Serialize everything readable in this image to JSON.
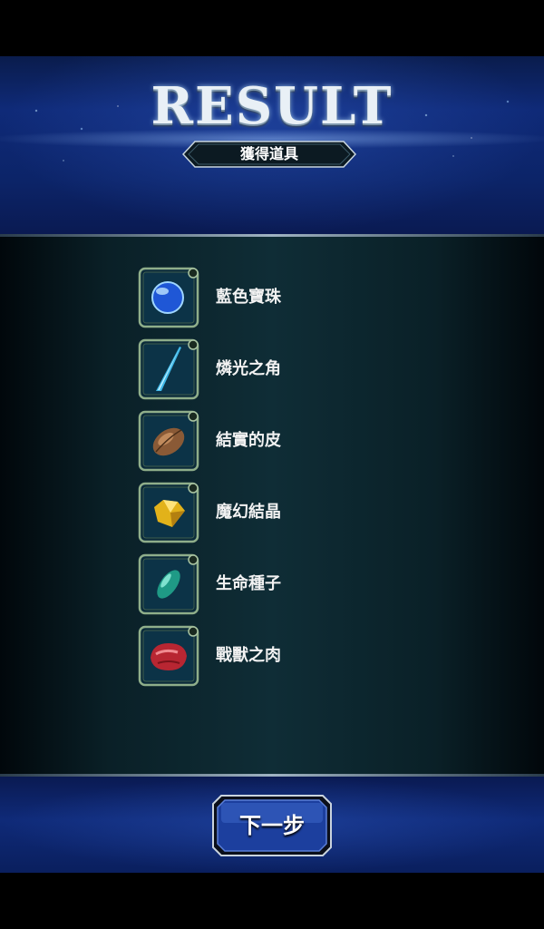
{
  "header": {
    "title": "RESULT",
    "subtitle": "獲得道具"
  },
  "items": [
    {
      "name": "藍色寶珠",
      "icon": "blue-orb-icon"
    },
    {
      "name": "燐光之角",
      "icon": "horn-icon"
    },
    {
      "name": "結實的皮",
      "icon": "hide-icon"
    },
    {
      "name": "魔幻結晶",
      "icon": "crystal-icon"
    },
    {
      "name": "生命種子",
      "icon": "seed-icon"
    },
    {
      "name": "戰獸之肉",
      "icon": "meat-icon"
    }
  ],
  "footer": {
    "next_label": "下一步"
  },
  "colors": {
    "accent_blue": "#0f2a78",
    "frame_green": "#8fae8a",
    "panel_teal": "#0f2d36"
  }
}
